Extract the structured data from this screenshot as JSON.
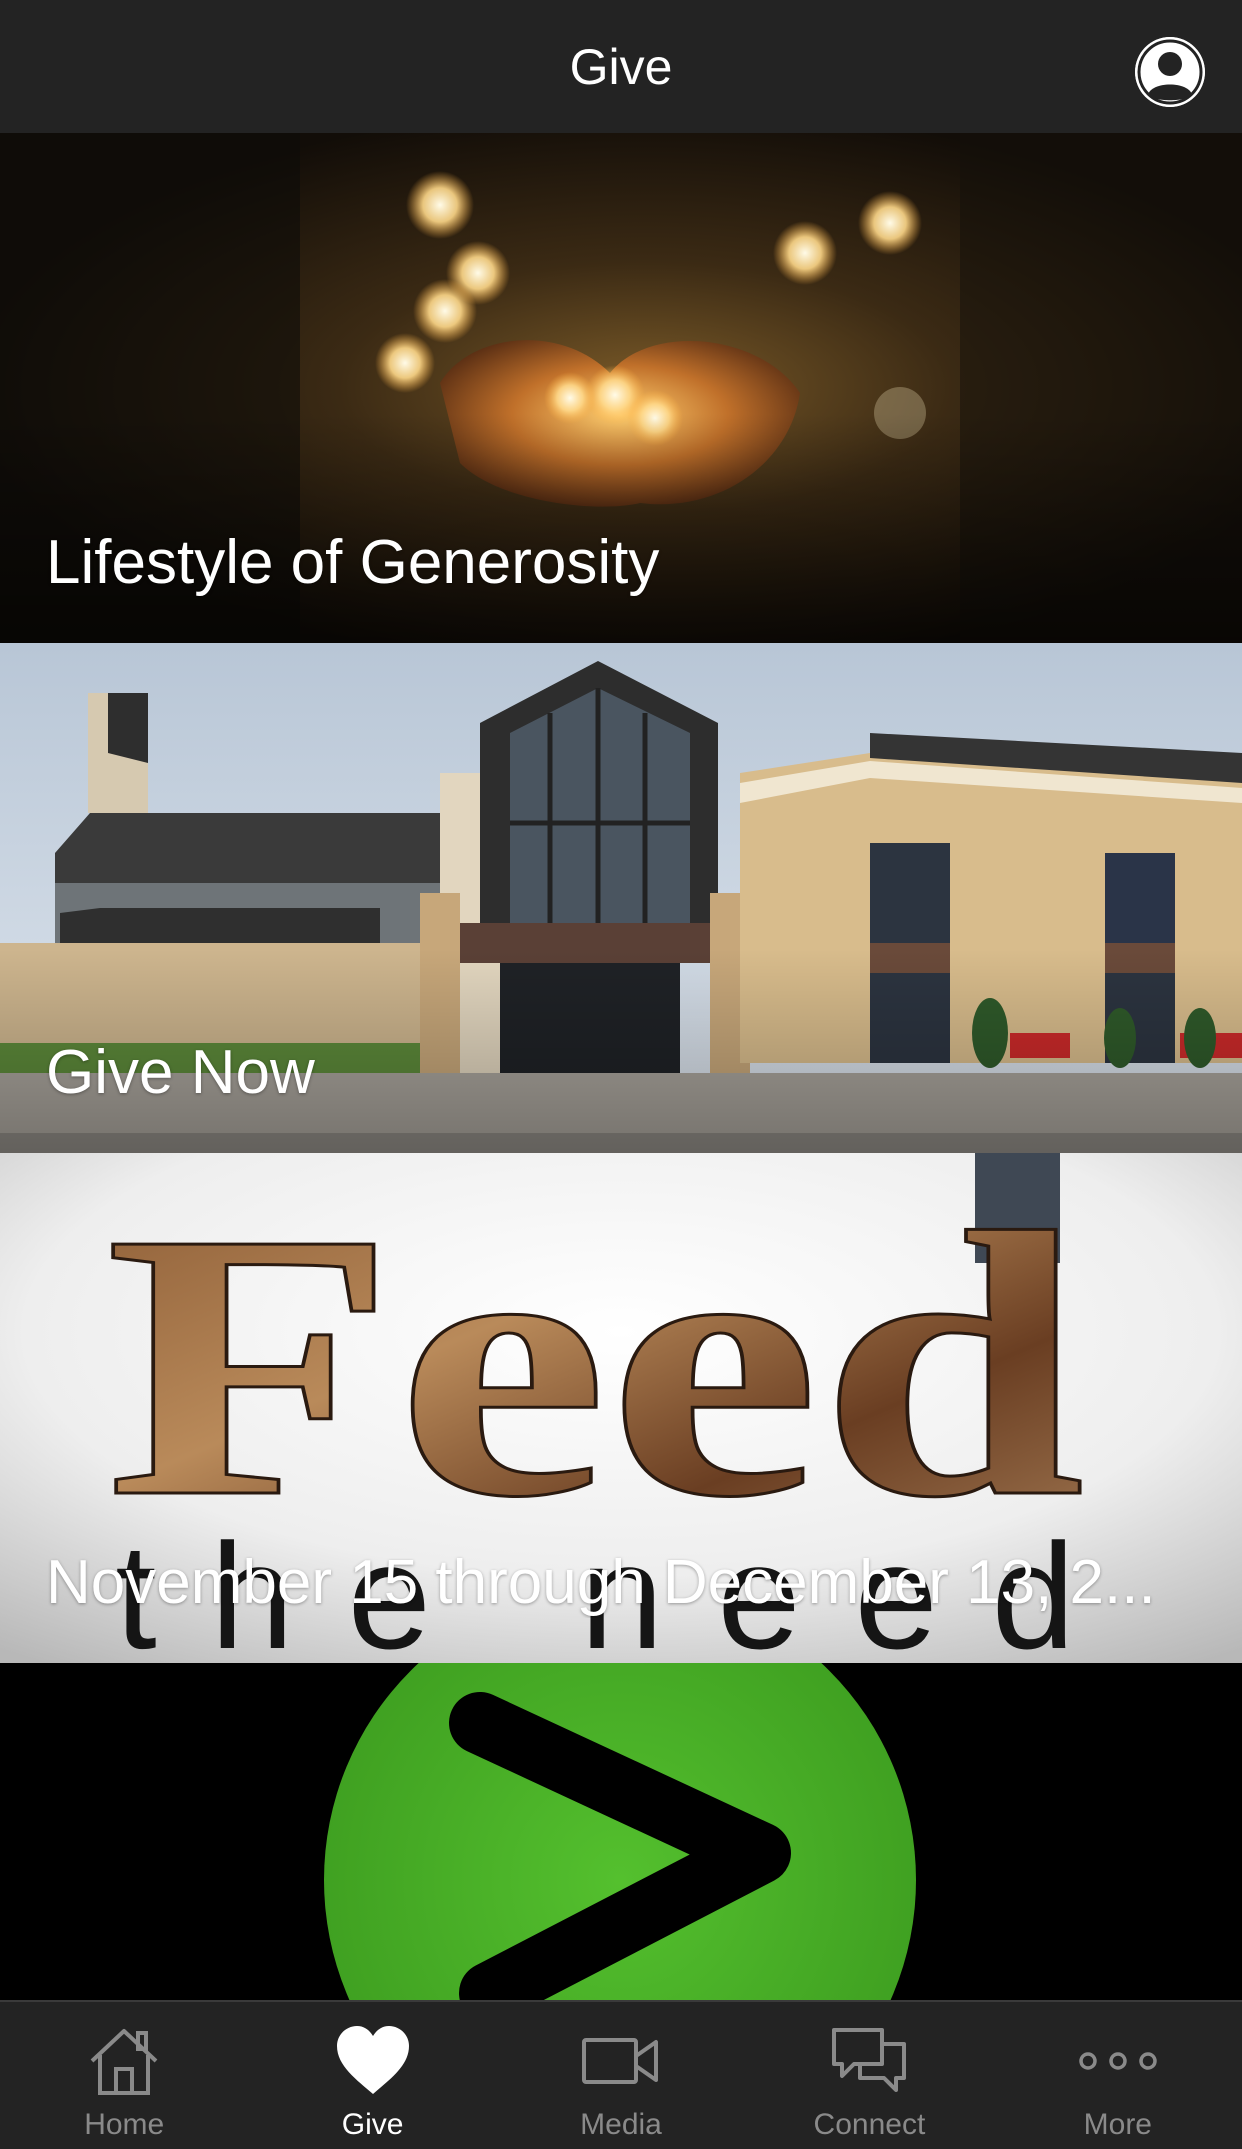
{
  "header": {
    "title": "Give",
    "profile_icon": "user-circle-icon"
  },
  "cards": [
    {
      "label": "Lifestyle of Generosity",
      "image": "hands-holding-string-lights"
    },
    {
      "label": "Give Now",
      "image": "church-building-exterior"
    },
    {
      "label": "November 15 through December 13, 2...",
      "image": "feed-the-need-bread-graphic",
      "image_text": [
        "Feed",
        "the need"
      ]
    },
    {
      "label": "",
      "image": "green-circle-play-chevron"
    }
  ],
  "tabbar": {
    "items": [
      {
        "label": "Home",
        "icon": "home-icon",
        "active": false
      },
      {
        "label": "Give",
        "icon": "heart-icon",
        "active": true
      },
      {
        "label": "Media",
        "icon": "video-camera-icon",
        "active": false
      },
      {
        "label": "Connect",
        "icon": "chat-bubbles-icon",
        "active": false
      },
      {
        "label": "More",
        "icon": "more-dots-icon",
        "active": false
      }
    ]
  },
  "colors": {
    "header_bg": "#232323",
    "tabbar_bg": "#232323",
    "active_tab": "#ffffff",
    "inactive_tab": "#8a8a8a",
    "accent_green": "#4cb82a"
  }
}
